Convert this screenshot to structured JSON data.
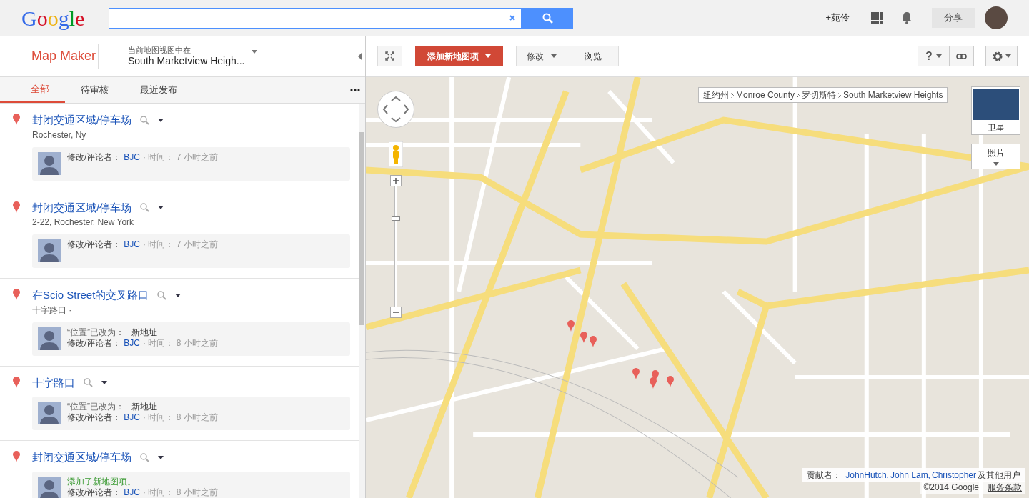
{
  "header": {
    "logo": "Google",
    "user": "+苑伶",
    "share": "分享"
  },
  "panel": {
    "title": "Map Maker",
    "view_label": "当前地图视图中在",
    "view_location": "South Marketview Heigh...",
    "tabs": [
      {
        "label": "全部",
        "selected": true
      },
      {
        "label": "待审核",
        "selected": false
      },
      {
        "label": "最近发布",
        "selected": false
      }
    ],
    "edits": [
      {
        "title": "封闭交通区域/停车场",
        "subtitle": "Rochester, Ny",
        "editor_label": "修改/评论者：",
        "editor": "BJC",
        "time": "· 时间： 7 小时之前"
      },
      {
        "title": "封闭交通区域/停车场",
        "subtitle": "2-22, Rochester, New York",
        "editor_label": "修改/评论者：",
        "editor": "BJC",
        "time": "· 时间： 7 小时之前"
      },
      {
        "title": "在Scio Street的交叉路口",
        "subtitle": "十字路口 ·",
        "change_label": "“位置”已改为：",
        "change_value": "新地址",
        "editor_label": "修改/评论者：",
        "editor": "BJC",
        "time": "· 时间： 8 小时之前"
      },
      {
        "title": "十字路口",
        "change_label": "“位置”已改为：",
        "change_value": "新地址",
        "editor_label": "修改/评论者：",
        "editor": "BJC",
        "time": "· 时间： 8 小时之前"
      },
      {
        "title": "封闭交通区域/停车场",
        "message": "添加了新地图项。",
        "editor_label": "修改/评论者：",
        "editor": "BJC",
        "time": "· 时间： 8 小时之前"
      }
    ]
  },
  "toolbar": {
    "add_button": "添加新地图项",
    "edit_button": "修改",
    "browse_button": "浏览",
    "help_button": "?"
  },
  "map": {
    "breadcrumb": [
      "纽约州",
      "Monroe County",
      "罗切斯特",
      "South Marketview Heights"
    ],
    "satellite": "卫星",
    "photos": "照片",
    "attribution_label": "贡献者：",
    "contributors": [
      "JohnHutch,",
      "John Lam,",
      "Christopher"
    ],
    "zoom": {
      "level": 0.73
    },
    "attribution_suffix": "及其他用户",
    "copyright": "©2014 Google",
    "terms": "服务条款"
  }
}
